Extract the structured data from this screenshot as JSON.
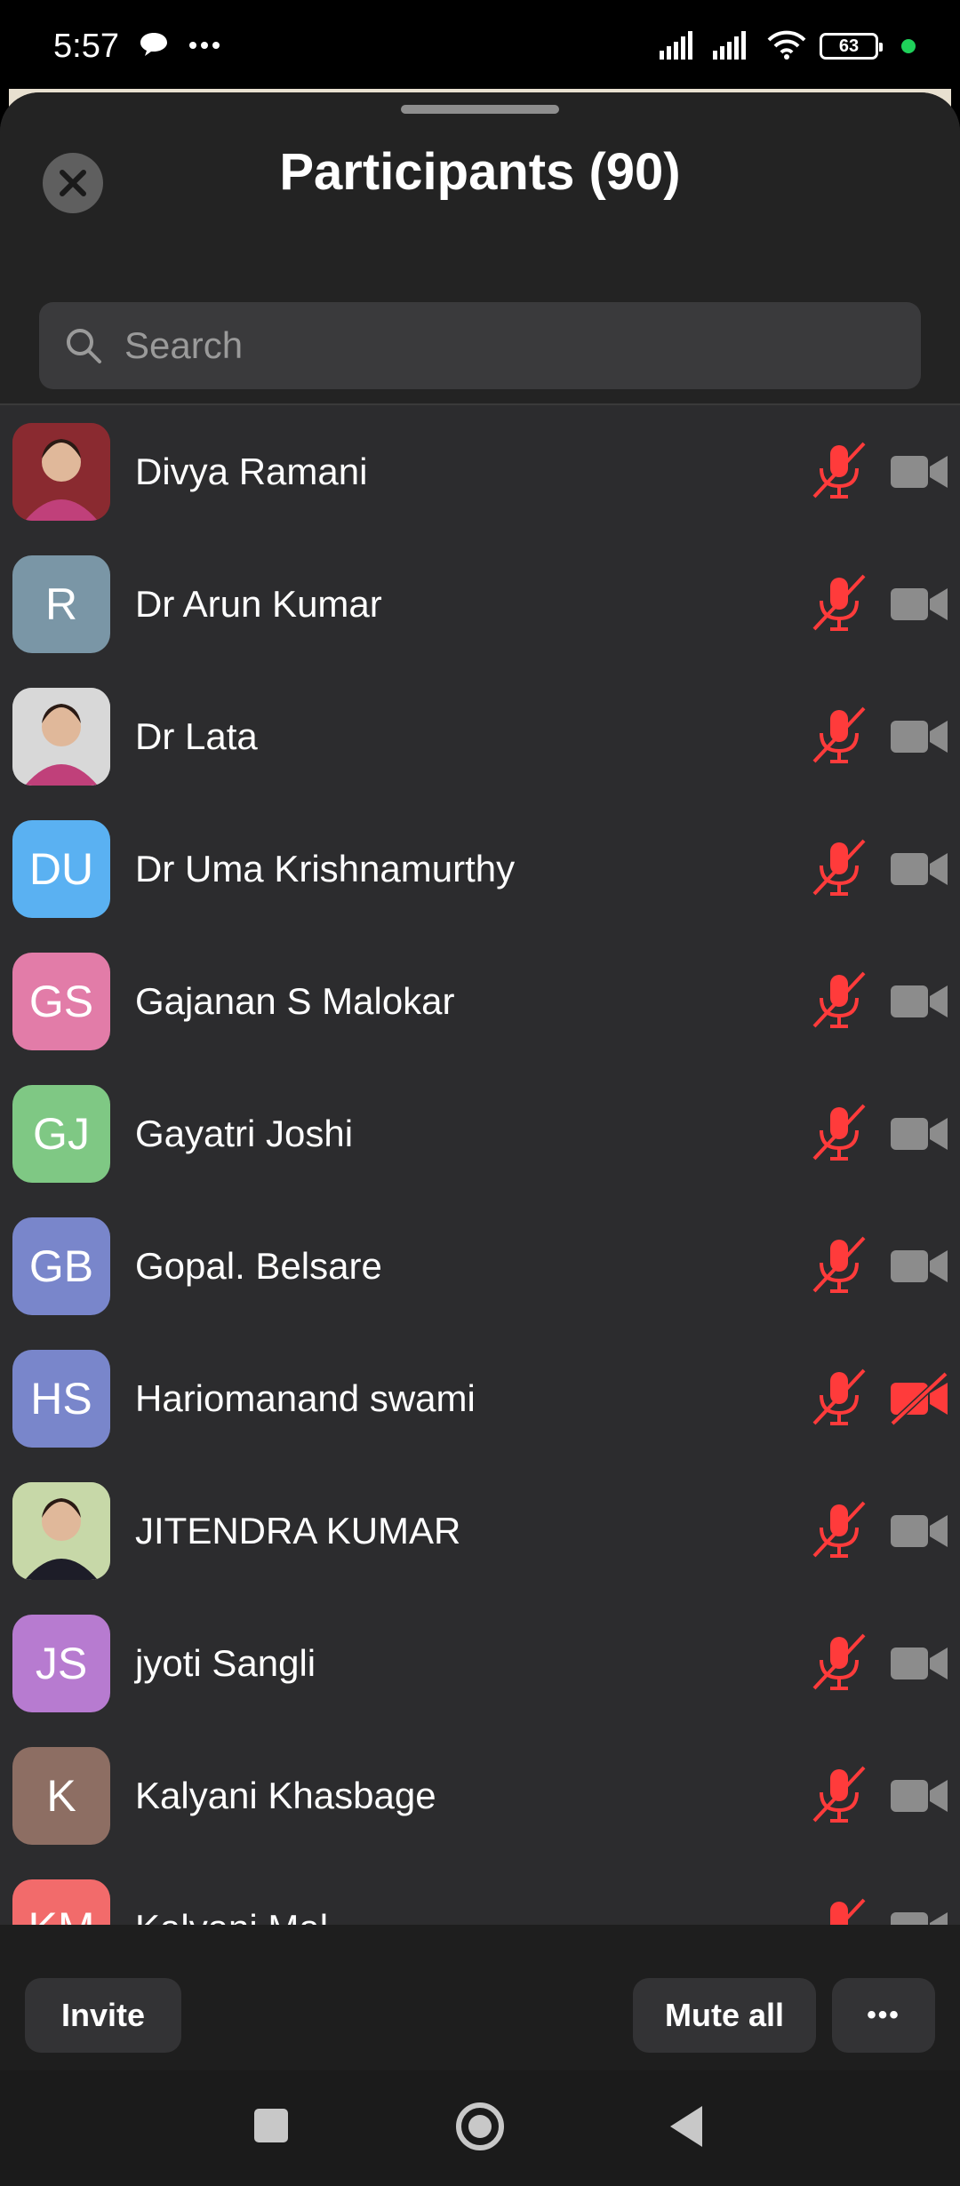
{
  "status": {
    "time": "5:57",
    "battery": "63"
  },
  "header": {
    "title": "Participants (90)"
  },
  "search": {
    "placeholder": "Search"
  },
  "participants": [
    {
      "initials": "",
      "name": "Divya Ramani",
      "avatar_color": "#8a2a30",
      "photo": true,
      "mic": "muted",
      "camera": "on"
    },
    {
      "initials": "R",
      "name": "Dr Arun Kumar",
      "avatar_color": "#7a96a6",
      "photo": false,
      "mic": "muted",
      "camera": "on"
    },
    {
      "initials": "",
      "name": "Dr Lata",
      "avatar_color": "#d8d8d8",
      "photo": true,
      "mic": "muted",
      "camera": "on"
    },
    {
      "initials": "DU",
      "name": "Dr Uma Krishnamurthy",
      "avatar_color": "#5ab1f2",
      "photo": false,
      "mic": "muted",
      "camera": "on"
    },
    {
      "initials": "GS",
      "name": "Gajanan S Malokar",
      "avatar_color": "#e27ca8",
      "photo": false,
      "mic": "muted",
      "camera": "on"
    },
    {
      "initials": "GJ",
      "name": "Gayatri Joshi",
      "avatar_color": "#7fc884",
      "photo": false,
      "mic": "muted",
      "camera": "on"
    },
    {
      "initials": "GB",
      "name": "Gopal. Belsare",
      "avatar_color": "#7986cb",
      "photo": false,
      "mic": "muted",
      "camera": "on"
    },
    {
      "initials": "HS",
      "name": "Hariomanand swami",
      "avatar_color": "#7986cb",
      "photo": false,
      "mic": "muted",
      "camera": "off"
    },
    {
      "initials": "",
      "name": "JITENDRA KUMAR",
      "avatar_color": "#c7d8a8",
      "photo": true,
      "mic": "muted",
      "camera": "on"
    },
    {
      "initials": "JS",
      "name": "jyoti Sangli",
      "avatar_color": "#b77bd0",
      "photo": false,
      "mic": "muted",
      "camera": "on"
    },
    {
      "initials": "K",
      "name": "Kalyani Khasbage",
      "avatar_color": "#8d6e63",
      "photo": false,
      "mic": "muted",
      "camera": "on"
    },
    {
      "initials": "KM",
      "name": "Kalyani Mal",
      "avatar_color": "#f26b6b",
      "photo": false,
      "mic": "muted",
      "camera": "on"
    }
  ],
  "footer": {
    "invite": "Invite",
    "mute_all": "Mute all",
    "more": "•••"
  }
}
